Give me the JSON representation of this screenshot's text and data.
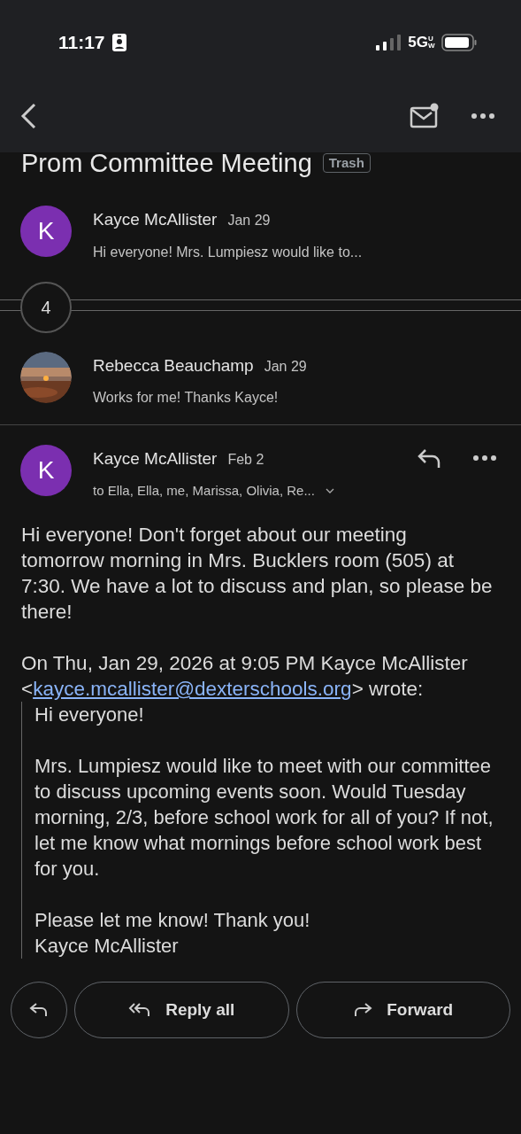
{
  "status_bar": {
    "time": "11:17",
    "network": "5G",
    "network_sub": "UW"
  },
  "subject": {
    "title": "Prom Committee Meeting",
    "label": "Trash"
  },
  "thread": [
    {
      "kind": "letter",
      "initial": "K",
      "color": "#7b2fb0",
      "sender": "Kayce McAllister",
      "date": "Jan 29",
      "snippet": "Hi everyone! Mrs. Lumpiesz would like to..."
    },
    {
      "kind": "collapsed",
      "count": "4"
    },
    {
      "sender": "Rebecca Beauchamp",
      "date": "Jan 29",
      "snippet": "Works for me! Thanks Kayce!"
    }
  ],
  "open_message": {
    "initial": "K",
    "color": "#7b2fb0",
    "sender": "Kayce McAllister",
    "date": "Feb 2",
    "recipients": "to Ella, Ella, me, Marissa, Olivia, Re...",
    "body": "Hi everyone! Don't forget about our meeting tomorrow morning in Mrs. Bucklers room (505) at 7:30. We have a lot to discuss and plan, so please be there!",
    "quote_header": "On Thu, Jan 29, 2026 at 9:05 PM Kayce McAllister <",
    "quote_link": "kayce.mcallister@dexterschools.org",
    "quote_header_end": "> wrote:",
    "quote": [
      [
        "Hi everyone!"
      ],
      [
        "Mrs. Lumpiesz would like to meet with our committee to discuss upcoming events soon. Would Tuesday morning, 2/3, before school work for all of you? If not, let me know what mornings before school work best for you."
      ],
      [
        "Please let me know! Thank you!",
        "Kayce McAllister"
      ]
    ]
  },
  "actions": {
    "reply_all": "Reply all",
    "forward": "Forward"
  }
}
